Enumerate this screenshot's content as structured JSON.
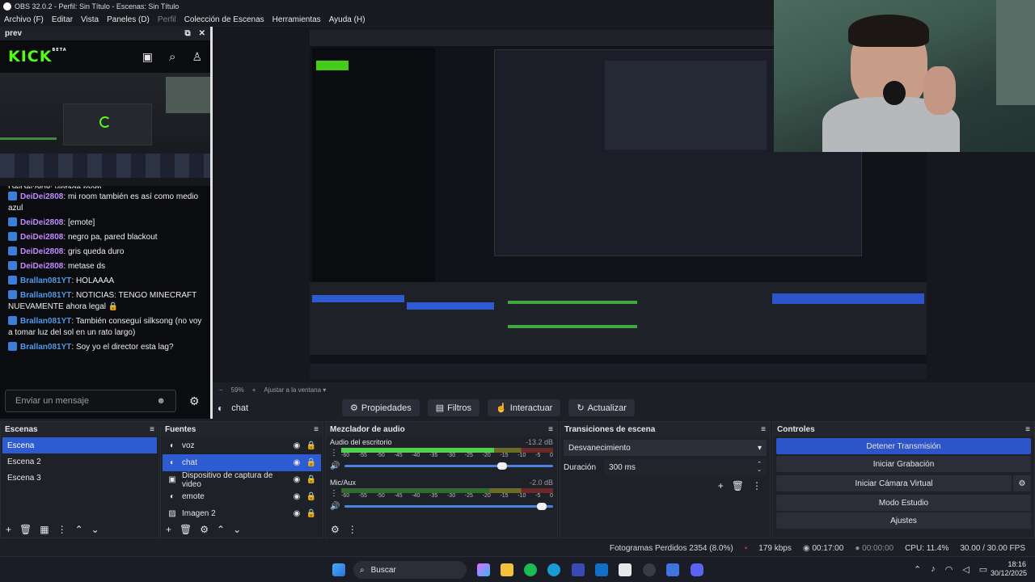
{
  "window": {
    "title": "OBS 32.0.2 - Perfil: Sin Título - Escenas: Sin Título"
  },
  "menu": [
    "Archivo (F)",
    "Editar",
    "Vista",
    "Paneles (D)",
    "Perfil",
    "Colección de Escenas",
    "Herramientas",
    "Ayuda (H)"
  ],
  "dock": {
    "title": "prev",
    "brand": "KICK",
    "brand_sup": "BETA"
  },
  "chat": {
    "partial": "DeiDei2808: vintage room",
    "messages": [
      {
        "user": "DeiDei2808",
        "cls": "u1",
        "text": "mi room también es así como medio azul"
      },
      {
        "user": "DeiDei2808",
        "cls": "u1",
        "text": "[emote]"
      },
      {
        "user": "DeiDei2808",
        "cls": "u1",
        "text": "negro pa, pared blackout"
      },
      {
        "user": "DeiDei2808",
        "cls": "u1",
        "text": "gris queda duro"
      },
      {
        "user": "DeiDei2808",
        "cls": "u1",
        "text": "metase ds"
      },
      {
        "user": "Brallan081YT",
        "cls": "u2",
        "text": "HOLAAAA"
      },
      {
        "user": "Brallan081YT",
        "cls": "u2",
        "text": "NOTICIAS: TENGO MINECRAFT NUEVAMENTE ahora legal 🔒"
      },
      {
        "user": "Brallan081YT",
        "cls": "u2",
        "text": "También conseguí silksong (no voy a tomar luz del sol en un rato largo)"
      },
      {
        "user": "Brallan081YT",
        "cls": "u2",
        "text": "Soy yo el director esta lag?"
      }
    ],
    "input_placeholder": "Enviar un mensaje"
  },
  "zoom": {
    "minus": "−",
    "value": "59%",
    "plus": "+",
    "fit": "Ajustar a la ventana"
  },
  "source_toolbar": {
    "selected": "chat",
    "properties": "Propiedades",
    "filters": "Filtros",
    "interact": "Interactuar",
    "refresh": "Actualizar"
  },
  "scenes": {
    "title": "Escenas",
    "items": [
      "Escena",
      "Escena 2",
      "Escena 3"
    ],
    "selected": 0
  },
  "sources": {
    "title": "Fuentes",
    "items": [
      "voz",
      "chat",
      "Dispositivo de captura de video",
      "emote",
      "Imagen 2"
    ],
    "selected": 1
  },
  "mixer": {
    "title": "Mezclador de audio",
    "scale": [
      "-60",
      "-55",
      "-50",
      "-45",
      "-40",
      "-35",
      "-30",
      "-25",
      "-20",
      "-15",
      "-10",
      "-5",
      "0"
    ],
    "channels": [
      {
        "name": "Audio del escritorio",
        "db": "-13.2 dB",
        "level": 0.72,
        "volume": 0.78
      },
      {
        "name": "Mic/Aux",
        "db": "-2.0 dB",
        "level": 0.0,
        "volume": 0.97
      }
    ]
  },
  "transitions": {
    "title": "Transiciones de escena",
    "selected": "Desvanecimiento",
    "duration_label": "Duración",
    "duration": "300 ms"
  },
  "controls": {
    "title": "Controles",
    "buttons": [
      "Detener Transmisión",
      "Iniciar Grabación",
      "Iniciar Cámara Virtual",
      "Modo Estudio",
      "Ajustes"
    ]
  },
  "status": {
    "dropped": "Fotogramas Perdidos 2354 (8.0%)",
    "kbps": "179 kbps",
    "live": "00:17:00",
    "rec": "00:00:00",
    "cpu": "CPU: 11.4%",
    "fps": "30.00 / 30.00 FPS"
  },
  "taskbar": {
    "search": "Buscar",
    "time": "18:16",
    "date": "30/12/2025"
  },
  "colors": {
    "accent": "#2d5bd1",
    "kick": "#53fc18",
    "bg": "#1f2128"
  }
}
